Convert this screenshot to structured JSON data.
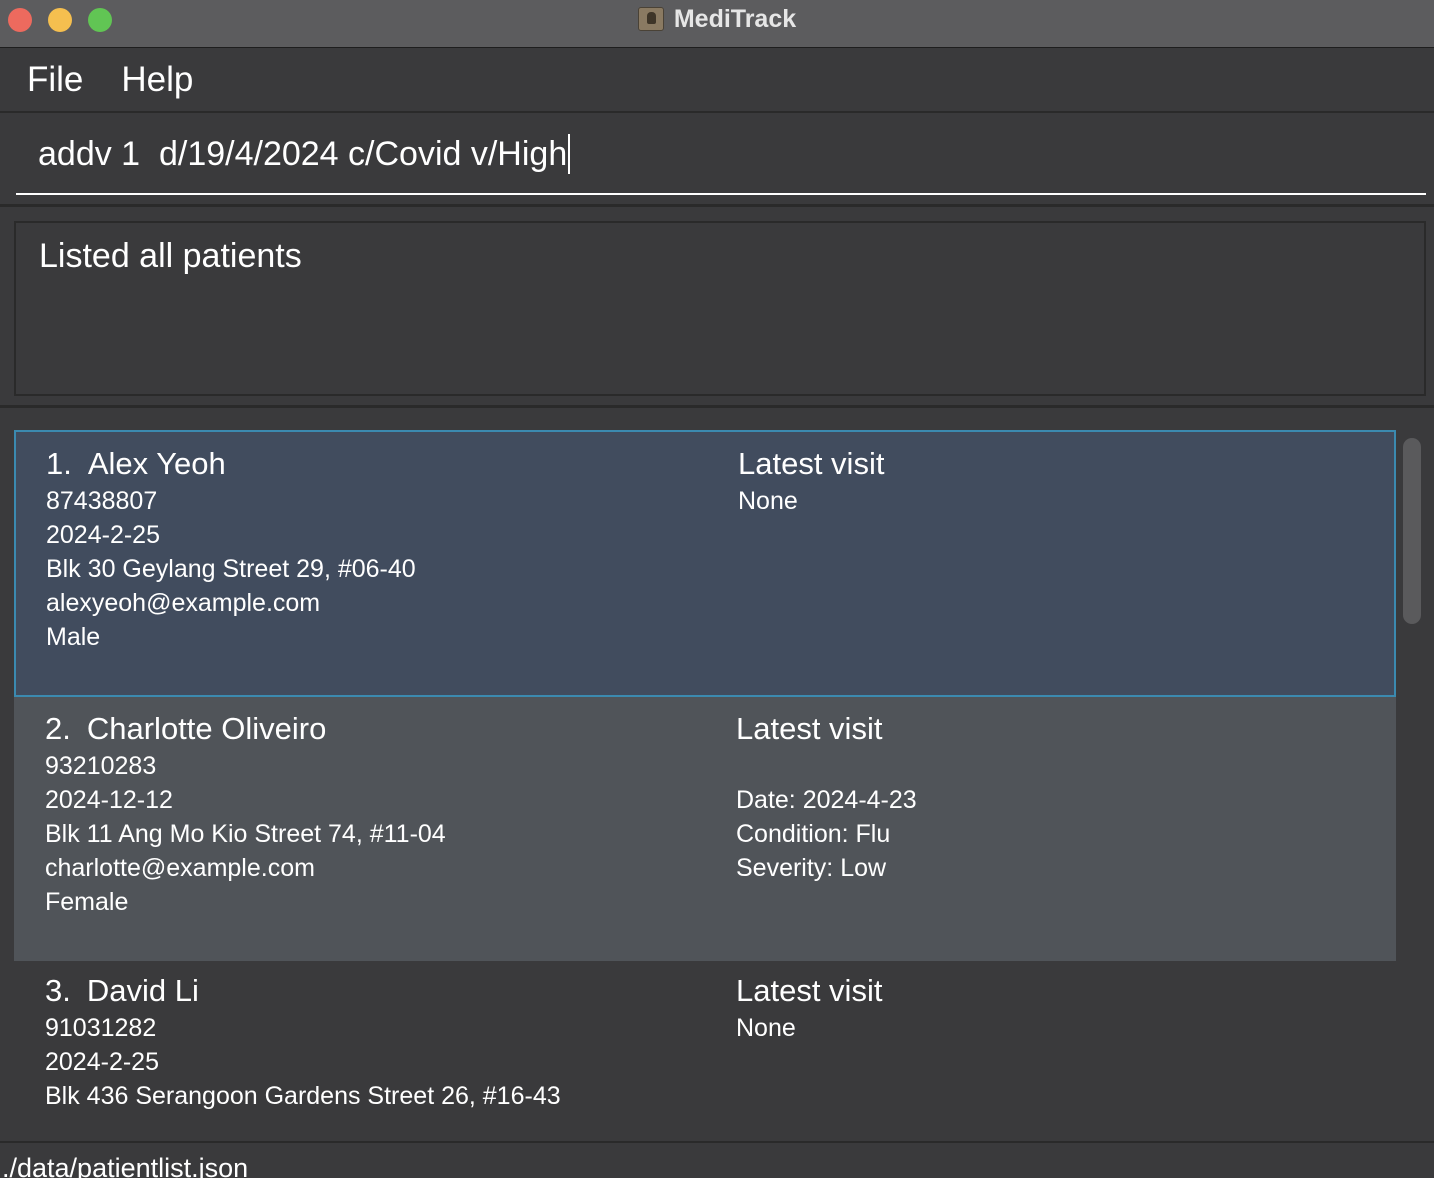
{
  "window": {
    "title": "MediTrack"
  },
  "menu": {
    "file": "File",
    "help": "Help"
  },
  "command": {
    "value": "addv 1  d/19/4/2024 c/Covid v/High"
  },
  "result": {
    "message": "Listed all patients"
  },
  "patients": [
    {
      "index": "1.",
      "name": "Alex Yeoh",
      "phone": "87438807",
      "date": "2024-2-25",
      "address": "Blk 30 Geylang Street 29, #06-40",
      "email": "alexyeoh@example.com",
      "gender": "Male",
      "visit_title": "Latest visit",
      "visit_none": "None"
    },
    {
      "index": "2.",
      "name": "Charlotte Oliveiro",
      "phone": "93210283",
      "date": "2024-12-12",
      "address": "Blk 11 Ang Mo Kio Street 74, #11-04",
      "email": "charlotte@example.com",
      "gender": "Female",
      "visit_title": "Latest visit",
      "visit_date": "Date: 2024-4-23",
      "visit_condition": "Condition: Flu",
      "visit_severity": "Severity: Low"
    },
    {
      "index": "3.",
      "name": "David Li",
      "phone": "91031282",
      "date": "2024-2-25",
      "address": "Blk 436 Serangoon Gardens Street 26, #16-43",
      "visit_title": "Latest visit",
      "visit_none": "None"
    }
  ],
  "status": {
    "path": "./data/patientlist.json"
  },
  "colors": {
    "background": "#3a3a3c",
    "selected_card": "#414c5e",
    "selected_border": "#3b8ab0",
    "alt_card": "#505459"
  },
  "icons": [
    "close-button",
    "minimize-button",
    "maximize-button",
    "app-icon"
  ]
}
